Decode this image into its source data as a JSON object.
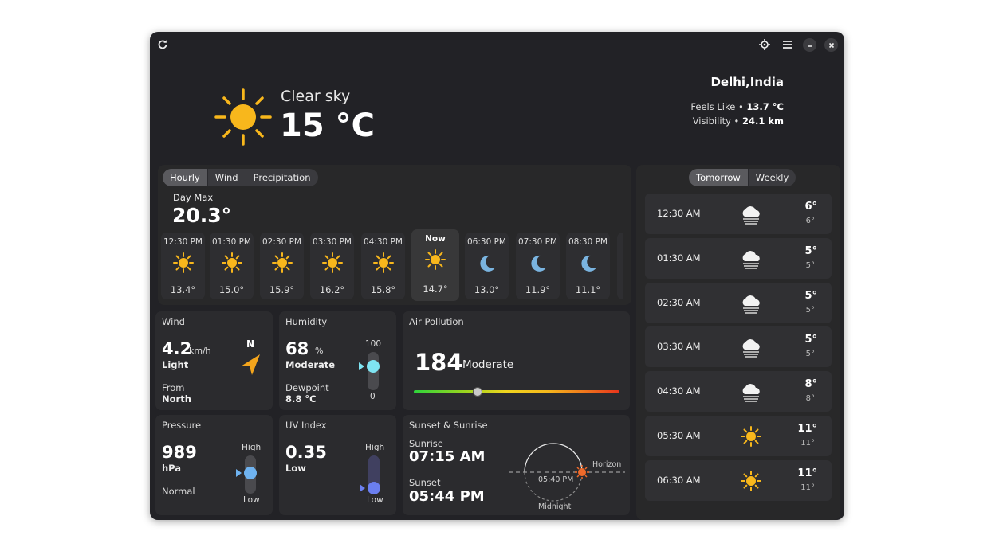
{
  "current": {
    "condition": "Clear sky",
    "temperature": "15 °C",
    "location": "Delhi,India",
    "feels_like_label": "Feels Like •",
    "feels_like_value": "13.7 °C",
    "visibility_label": "Visibility •",
    "visibility_value": "24.1 km"
  },
  "tabs_left": [
    "Hourly",
    "Wind",
    "Precipitation"
  ],
  "tabs_right": [
    "Tomorrow",
    "Weekly"
  ],
  "hourly": {
    "day_max_label": "Day Max",
    "day_max_value": "20.3°",
    "items": [
      {
        "time": "12:30 PM",
        "temp": "13.4°",
        "icon": "sun-icon"
      },
      {
        "time": "01:30 PM",
        "temp": "15.0°",
        "icon": "sun-icon"
      },
      {
        "time": "02:30 PM",
        "temp": "15.9°",
        "icon": "sun-icon"
      },
      {
        "time": "03:30 PM",
        "temp": "16.2°",
        "icon": "sun-icon"
      },
      {
        "time": "04:30 PM",
        "temp": "15.8°",
        "icon": "sun-icon"
      },
      {
        "time": "Now",
        "temp": "14.7°",
        "icon": "sun-icon"
      },
      {
        "time": "06:30 PM",
        "temp": "13.0°",
        "icon": "moon-icon"
      },
      {
        "time": "07:30 PM",
        "temp": "11.9°",
        "icon": "moon-icon"
      },
      {
        "time": "08:30 PM",
        "temp": "11.1°",
        "icon": "moon-icon"
      }
    ]
  },
  "wind": {
    "title": "Wind",
    "speed": "4.2",
    "unit": "km/h",
    "desc": "Light",
    "from_label": "From",
    "from_value": "North",
    "compass": "N"
  },
  "humidity": {
    "title": "Humidity",
    "value": "68",
    "unit": "%",
    "desc": "Moderate",
    "dewpoint_label": "Dewpoint",
    "dewpoint_value": "8.8 °C",
    "max_label": "100",
    "min_label": "0",
    "level": 68
  },
  "air": {
    "title": "Air Pollution",
    "value": "184",
    "desc": "Moderate"
  },
  "pressure": {
    "title": "Pressure",
    "value": "989",
    "unit": "hPa",
    "desc": "Normal",
    "high_label": "High",
    "low_label": "Low"
  },
  "uv": {
    "title": "UV Index",
    "value": "0.35",
    "desc": "Low",
    "high_label": "High",
    "low_label": "Low"
  },
  "sun": {
    "title": "Sunset & Sunrise",
    "sunrise_label": "Sunrise",
    "sunrise": "07:15 AM",
    "sunset_label": "Sunset",
    "sunset": "05:44 PM",
    "current_time": "05:40 PM",
    "horizon_label": "Horizon",
    "midnight_label": "Midnight"
  },
  "forecast": [
    {
      "time": "12:30 AM",
      "hi": "6°",
      "lo": "6°",
      "icon": "fog-icon"
    },
    {
      "time": "01:30 AM",
      "hi": "5°",
      "lo": "5°",
      "icon": "fog-icon"
    },
    {
      "time": "02:30 AM",
      "hi": "5°",
      "lo": "5°",
      "icon": "fog-icon"
    },
    {
      "time": "03:30 AM",
      "hi": "5°",
      "lo": "5°",
      "icon": "fog-icon"
    },
    {
      "time": "04:30 AM",
      "hi": "8°",
      "lo": "8°",
      "icon": "fog-icon"
    },
    {
      "time": "05:30 AM",
      "hi": "11°",
      "lo": "11°",
      "icon": "sun-icon"
    },
    {
      "time": "06:30 AM",
      "hi": "11°",
      "lo": "11°",
      "icon": "sun-icon"
    }
  ],
  "colors": {
    "sun": "#f8b71c",
    "moon": "#7ab4e0",
    "accent": "#6fb3f0",
    "humidity": "#7fe4f2",
    "uv": "#6b7ff0",
    "sun_marker": "#f06a2a"
  }
}
